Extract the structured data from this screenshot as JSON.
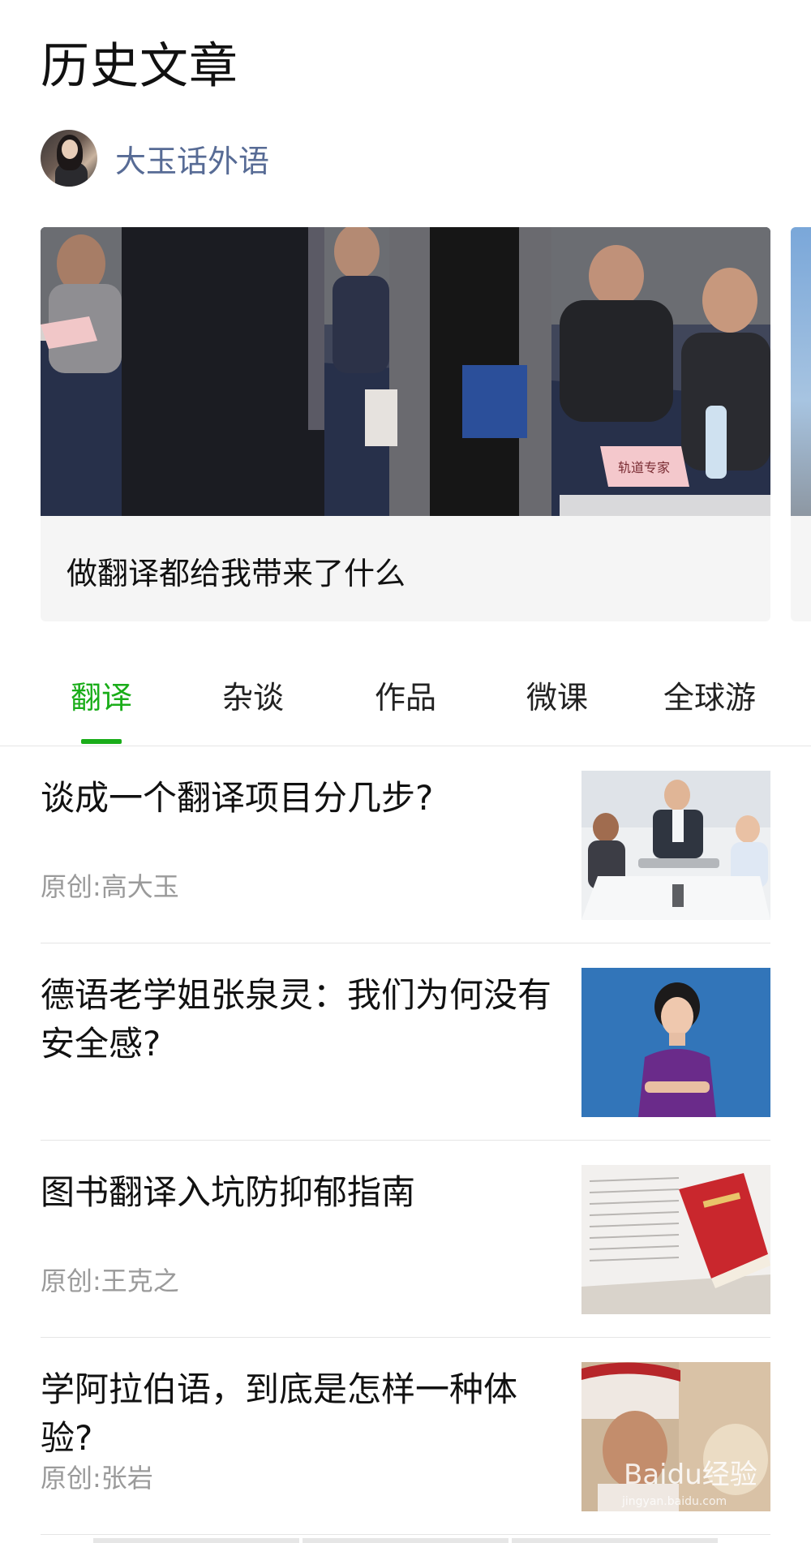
{
  "header": {
    "page_title": "历史文章",
    "account_name": "大玉话外语"
  },
  "featured": {
    "title": "做翻译都给我带来了什么",
    "name_card_text": "轨道专家"
  },
  "tabs": [
    {
      "label": "翻译",
      "active": true
    },
    {
      "label": "杂谈",
      "active": false
    },
    {
      "label": "作品",
      "active": false
    },
    {
      "label": "微课",
      "active": false
    },
    {
      "label": "全球游",
      "active": false
    }
  ],
  "articles": [
    {
      "title": "谈成一个翻译项目分几步?",
      "source": "原创:高大玉"
    },
    {
      "title": "德语老学姐张泉灵：我们为何没有安全感?",
      "source": ""
    },
    {
      "title": "图书翻译入坑防抑郁指南",
      "source": "原创:王克之"
    },
    {
      "title": "学阿拉伯语，到底是怎样一种体验?",
      "source": "原创:张岩"
    }
  ],
  "watermark": {
    "logo_text": "Baidu经验",
    "url_text": "jingyan.baidu.com"
  },
  "colors": {
    "accent_green": "#1aad19",
    "account_blue": "#576b95",
    "meta_gray": "#9a9a9a"
  }
}
